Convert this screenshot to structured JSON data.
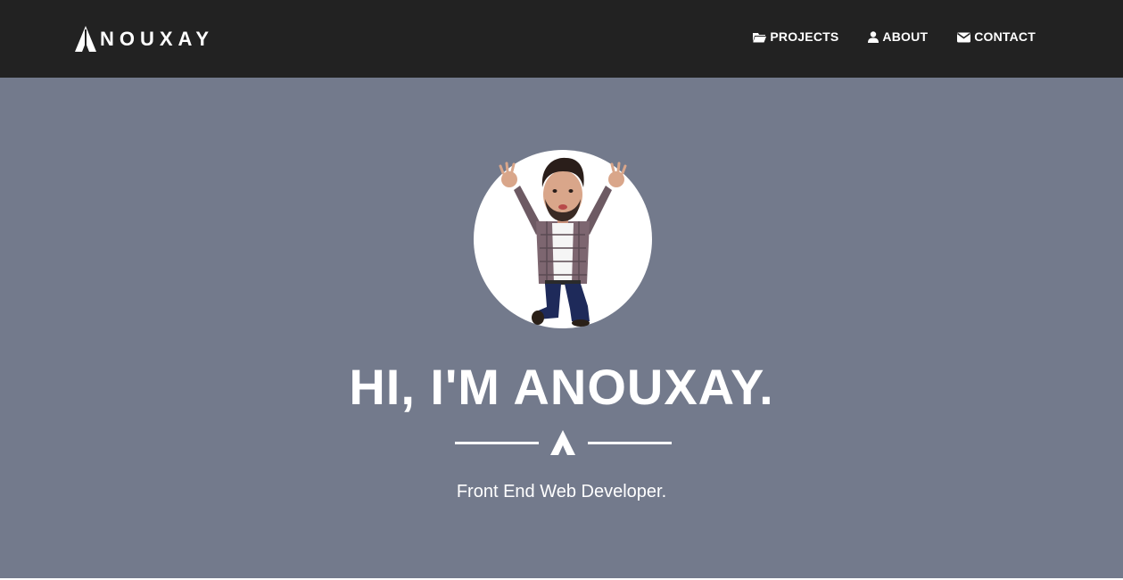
{
  "navbar": {
    "brand": {
      "first_letter": "A",
      "rest": "NOUXAY"
    },
    "links": [
      {
        "label": "PROJECTS",
        "icon": "folder-open-icon"
      },
      {
        "label": "ABOUT",
        "icon": "user-icon"
      },
      {
        "label": "CONTACT",
        "icon": "envelope-icon"
      }
    ]
  },
  "hero": {
    "avatar_description": "cartoon-avatar",
    "title": "HI, I'M ANOUXAY.",
    "subtitle": "Front End Web Developer."
  },
  "colors": {
    "navbar_bg": "#222222",
    "hero_bg": "#737a8c",
    "text": "#ffffff"
  }
}
